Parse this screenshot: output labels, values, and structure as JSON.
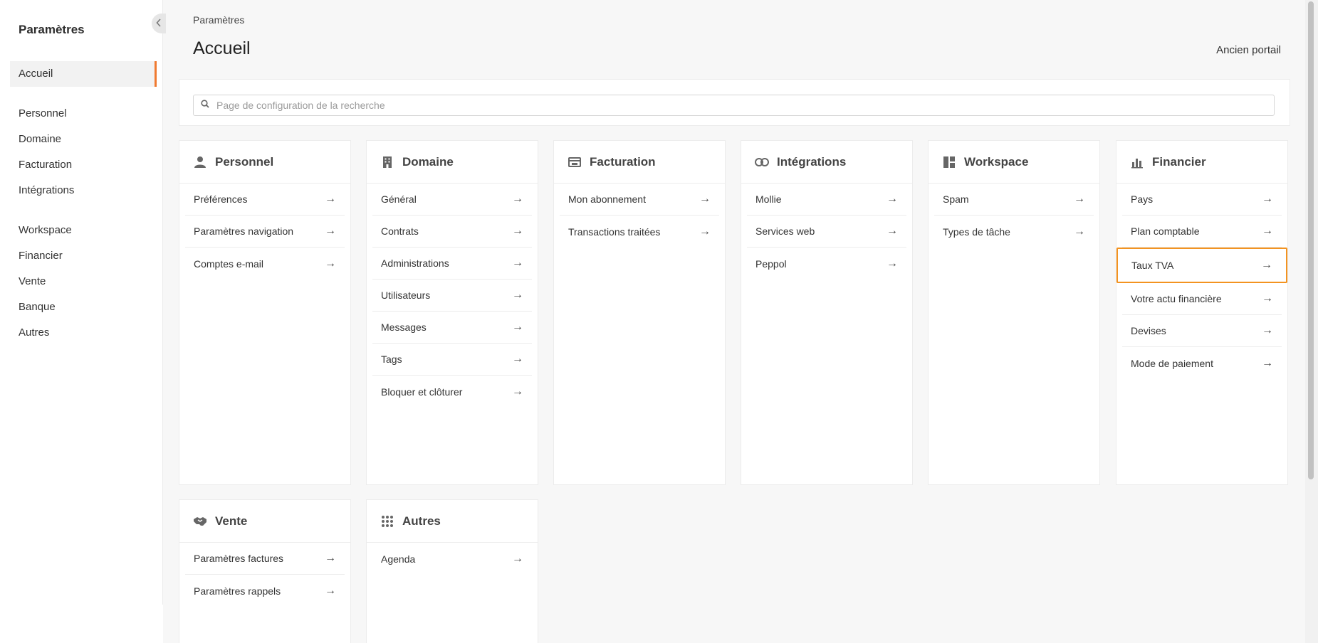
{
  "sidebar": {
    "title": "Paramètres",
    "collapse_icon": "chevron-left-icon",
    "items": [
      {
        "label": "Accueil",
        "active": true
      },
      {
        "label": "Personnel"
      },
      {
        "label": "Domaine"
      },
      {
        "label": "Facturation"
      },
      {
        "label": "Intégrations"
      },
      {
        "label": "Workspace"
      },
      {
        "label": "Financier"
      },
      {
        "label": "Vente"
      },
      {
        "label": "Banque"
      },
      {
        "label": "Autres"
      }
    ]
  },
  "header": {
    "breadcrumb": "Paramètres",
    "title": "Accueil",
    "old_portal": "Ancien portail"
  },
  "search": {
    "placeholder": "Page de configuration de la recherche",
    "icon": "search-icon"
  },
  "cards": [
    {
      "title": "Personnel",
      "icon": "person-icon",
      "items": [
        "Préférences",
        "Paramètres navigation",
        "Comptes e-mail"
      ]
    },
    {
      "title": "Domaine",
      "icon": "building-icon",
      "items": [
        "Général",
        "Contrats",
        "Administrations",
        "Utilisateurs",
        "Messages",
        "Tags",
        "Bloquer et clôturer"
      ]
    },
    {
      "title": "Facturation",
      "icon": "billing-icon",
      "items": [
        "Mon abonnement",
        "Transactions traitées"
      ]
    },
    {
      "title": "Intégrations",
      "icon": "link-icon",
      "items": [
        "Mollie",
        "Services web",
        "Peppol"
      ]
    },
    {
      "title": "Workspace",
      "icon": "workspace-icon",
      "items": [
        "Spam",
        "Types de tâche"
      ]
    },
    {
      "title": "Financier",
      "icon": "bar-chart-icon",
      "items": [
        "Pays",
        "Plan comptable",
        "Taux TVA",
        "Votre actu financière",
        "Devises",
        "Mode de paiement"
      ]
    },
    {
      "title": "Vente",
      "icon": "handshake-icon",
      "items": [
        "Paramètres factures",
        "Paramètres rappels"
      ]
    },
    {
      "title": "Autres",
      "icon": "grid-icon",
      "items": [
        "Agenda"
      ]
    }
  ],
  "highlighted_item": "Taux TVA",
  "colors": {
    "accent": "#f07a30",
    "highlight_border": "#f39320"
  }
}
